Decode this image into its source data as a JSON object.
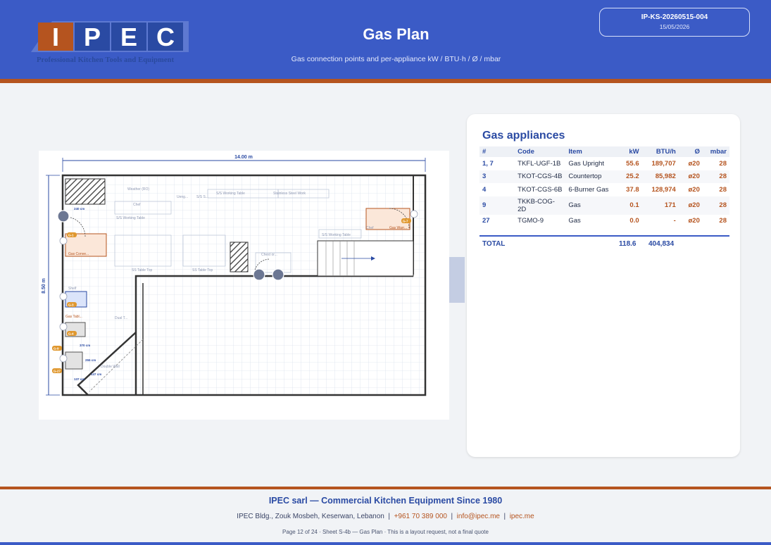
{
  "header": {
    "title": "Gas Plan",
    "subtitle": "Gas connection points and per-appliance kW / BTU·h / Ø / mbar",
    "ref_code": "IP-KS-20260515-004",
    "ref_date": "15/05/2026",
    "logo_letters": [
      "I",
      "P",
      "E",
      "C"
    ],
    "logo_tagline": "Professional Kitchen Tools and Equipment"
  },
  "colors": {
    "brand_blue": "#3b5bc6",
    "brand_orange": "#b5541f",
    "text_blue": "#2a4aa3"
  },
  "plan": {
    "width_label": "14.00 m",
    "height_label": "8.50 m",
    "room_labels": [
      "Gas Conve...",
      "S/S Working Table",
      "S/S Working Table",
      "Stainless Steel Work",
      "S/S Working Table",
      "SS Table Top",
      "SS Table Top",
      "Chef",
      "Gas Warr...",
      "Dual T...",
      "Double Wall",
      "Chef",
      "Chest or...",
      "Shelf",
      "Ueng...",
      "S/S S...",
      "Weather (RO)",
      "Gas Tabl..."
    ],
    "dim_labels": [
      "240 cm",
      "370 cm",
      "255 cm",
      "147 cm",
      "137 cm"
    ],
    "gas_tags": [
      "G-1",
      "G-3",
      "G-4",
      "G-9",
      "G-27",
      "G-7"
    ]
  },
  "appliances": {
    "title": "Gas appliances",
    "columns": [
      "#",
      "Code",
      "Item",
      "kW",
      "BTU/h",
      "Ø",
      "mbar"
    ],
    "rows": [
      {
        "idx": "1, 7",
        "code": "TKFL-UGF-1B",
        "item": "Gas Upright",
        "kw": "55.6",
        "btu": "189,707",
        "dia": "ø20",
        "mbar": "28"
      },
      {
        "idx": "3",
        "code": "TKOT-CGS-4B",
        "item": "Countertop",
        "kw": "25.2",
        "btu": "85,982",
        "dia": "ø20",
        "mbar": "28"
      },
      {
        "idx": "4",
        "code": "TKOT-CGS-6B",
        "item": "6-Burner Gas",
        "kw": "37.8",
        "btu": "128,974",
        "dia": "ø20",
        "mbar": "28"
      },
      {
        "idx": "9",
        "code": "TKKB-COG-2D",
        "item": "Gas",
        "kw": "0.1",
        "btu": "171",
        "dia": "ø20",
        "mbar": "28"
      },
      {
        "idx": "27",
        "code": "TGMO-9",
        "item": "Gas",
        "kw": "0.0",
        "btu": "-",
        "dia": "ø20",
        "mbar": "28"
      }
    ],
    "total_label": "TOTAL",
    "total_kw": "118.6",
    "total_btu": "404,834"
  },
  "footer": {
    "title": "IPEC sarl — Commercial Kitchen Equipment Since 1980",
    "address": "IPEC Bldg., Zouk Mosbeh, Keserwan, Lebanon",
    "phone": "+961 70 389 000",
    "email": "info@ipec.me",
    "website": "ipec.me",
    "page_info": "Page 12 of 24  ·  Sheet S-4b — Gas Plan  ·  This is a layout request, not a final quote"
  }
}
